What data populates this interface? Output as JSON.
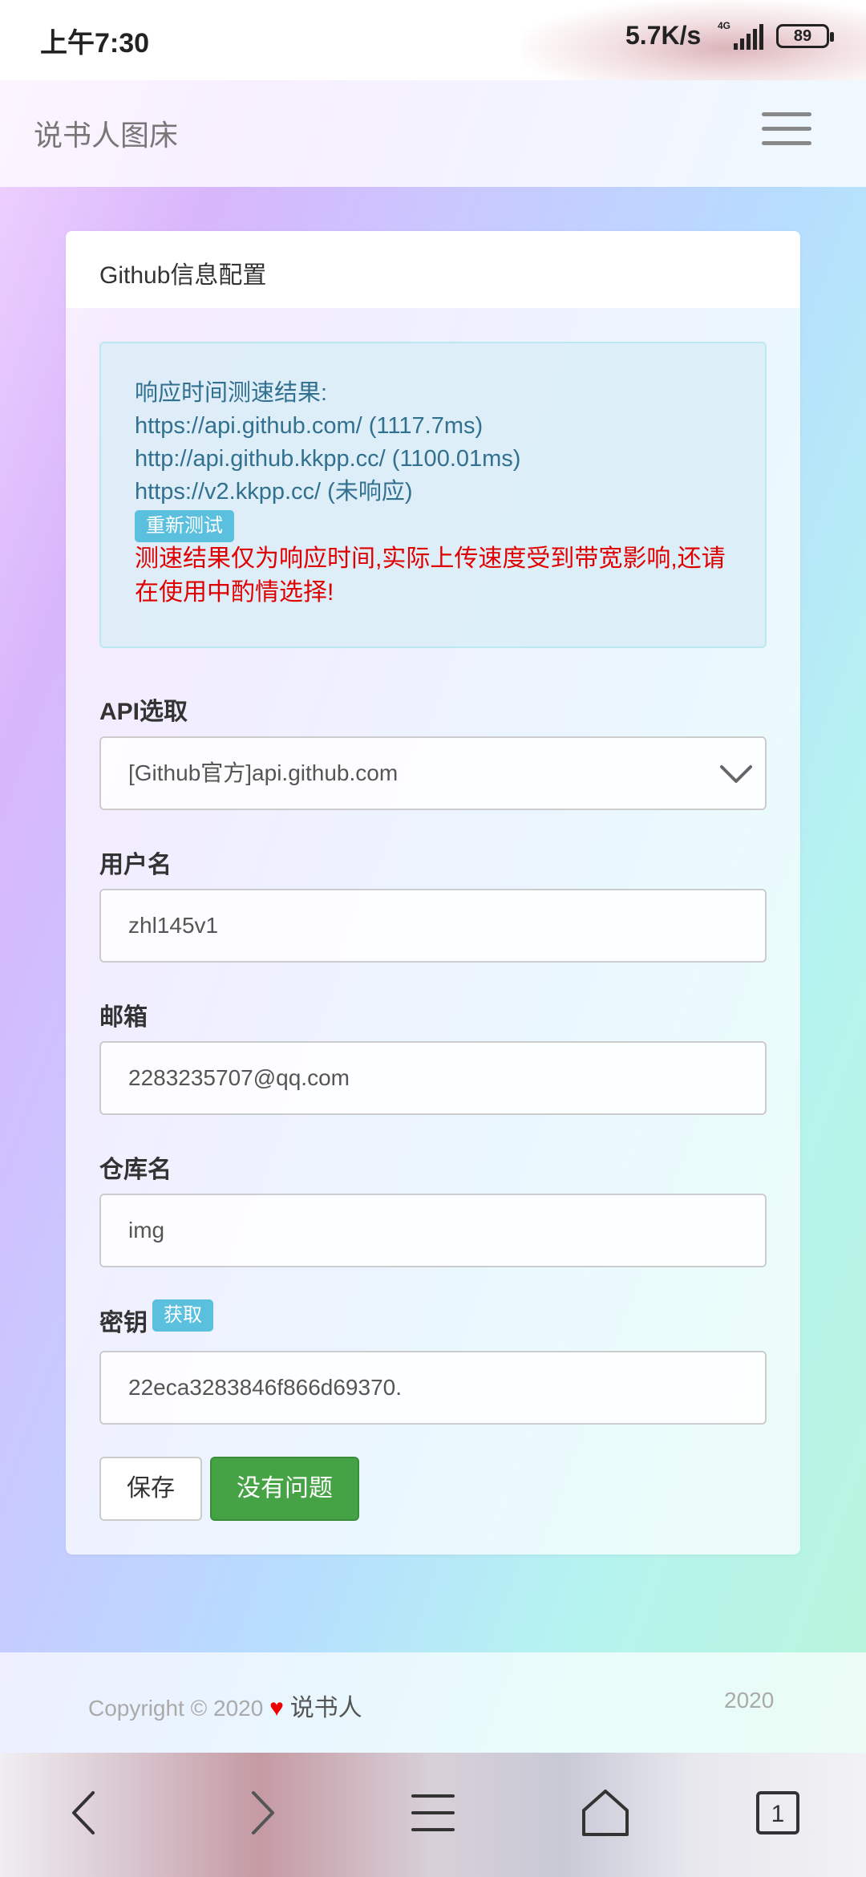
{
  "status_bar": {
    "time": "上午7:30",
    "speed": "5.7K/s",
    "network": "4G",
    "battery": "89"
  },
  "navbar": {
    "brand": "说书人图床",
    "menu_icon": "hamburger-icon"
  },
  "card": {
    "header": "Github信息配置",
    "speedtest": {
      "title": "响应时间测速结果:",
      "results": [
        "https://api.github.com/  (1117.7ms)",
        "http://api.github.kkpp.cc/  (1100.01ms)",
        "https://v2.kkpp.cc/  (未响应)"
      ],
      "retest_label": "重新测试",
      "warning": "测速结果仅为响应时间,实际上传速度受到带宽影响,还请在使用中酌情选择!"
    },
    "form": {
      "api_label": "API选取",
      "api_value": "[Github官方]api.github.com",
      "username_label": "用户名",
      "username_value": "zhl145v1",
      "email_label": "邮箱",
      "email_value": "2283235707@qq.com",
      "repo_label": "仓库名",
      "repo_value": "img",
      "key_label": "密钥",
      "key_get_label": "获取",
      "key_value": "22eca3283846f866d69370."
    },
    "buttons": {
      "save": "保存",
      "ok": "没有问题"
    }
  },
  "footer": {
    "copyright": "Copyright © 2020",
    "author": "说书人",
    "year": "2020"
  },
  "bottom_nav": {
    "icons": [
      "back-icon",
      "forward-icon",
      "menu-icon",
      "home-icon",
      "tabs-icon"
    ],
    "tab_count": "1"
  },
  "colors": {
    "alert_text": "#31708f",
    "warning_text": "#e00000",
    "info_badge": "#5bc0de",
    "success_button": "#45a245"
  }
}
